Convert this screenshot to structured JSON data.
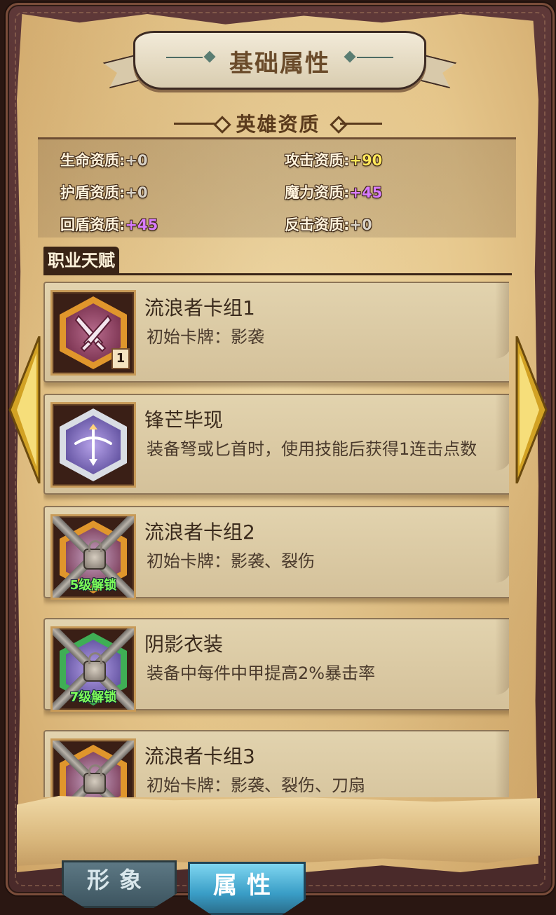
{
  "banner": {
    "title": "基础属性"
  },
  "aptitude": {
    "heading": "英雄资质",
    "stats": [
      {
        "label": "生命资质:",
        "value": "+0"
      },
      {
        "label": "攻击资质:",
        "value": "+90"
      },
      {
        "label": "护盾资质:",
        "value": "+0"
      },
      {
        "label": "魔力资质:",
        "value": "+45"
      },
      {
        "label": "回盾资质:",
        "value": "+45"
      },
      {
        "label": "反击资质:",
        "value": "+0"
      }
    ]
  },
  "talents": {
    "heading": "职业天赋",
    "items": [
      {
        "title": "流浪者卡组1",
        "desc": "初始卡牌：影袭",
        "level_badge": "1",
        "icon": "crossed-daggers-icon",
        "locked": false
      },
      {
        "title": "锋芒毕现",
        "desc": "装备弩或匕首时，使用技能后获得1连击点数",
        "icon": "crossbow-icon",
        "locked": false
      },
      {
        "title": "流浪者卡组2",
        "desc": "初始卡牌：影袭、裂伤",
        "unlock": "5级解锁",
        "icon": "chained-lock-icon",
        "locked": true
      },
      {
        "title": "阴影衣装",
        "desc": "装备中每件中甲提高2%暴击率",
        "unlock": "7级解锁",
        "icon": "chained-lock-icon",
        "locked": true
      },
      {
        "title": "流浪者卡组3",
        "desc": "初始卡牌：影袭、裂伤、刀扇",
        "icon": "chained-lock-icon",
        "locked": true
      }
    ]
  },
  "tabs": [
    {
      "label": "形象",
      "active": false
    },
    {
      "label": "属性",
      "active": true
    }
  ],
  "colors": {
    "yellow_value": "#ffe75a",
    "purple_value": "#d77cff",
    "zero_value": "#d8d2c6",
    "unlock_green": "#7dff5a"
  }
}
